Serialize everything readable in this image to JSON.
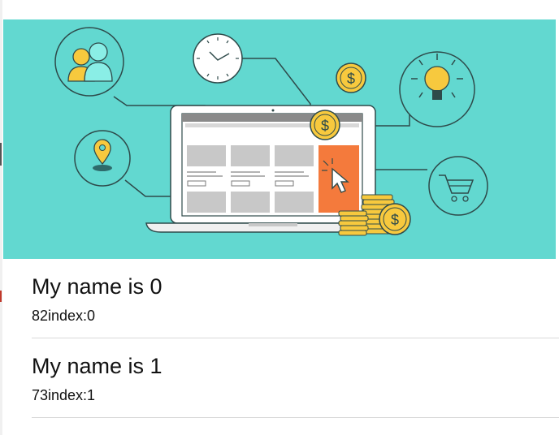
{
  "banner": {
    "icons": [
      "users-icon",
      "clock-icon",
      "dollar-coin-icon",
      "lightbulb-icon",
      "location-pin-icon",
      "laptop-icon",
      "cursor-icon",
      "shopping-cart-icon",
      "coin-stack-icon"
    ],
    "colors": {
      "background": "#62d8d0",
      "outline": "#2e4a4a",
      "accent_orange": "#f47a3c",
      "gold": "#f7c93e",
      "placeholder_gray": "#c8c8c8"
    }
  },
  "list": {
    "items": [
      {
        "title": "My name is 0",
        "subtitle": "82index:0"
      },
      {
        "title": "My name is 1",
        "subtitle": "73index:1"
      }
    ]
  }
}
